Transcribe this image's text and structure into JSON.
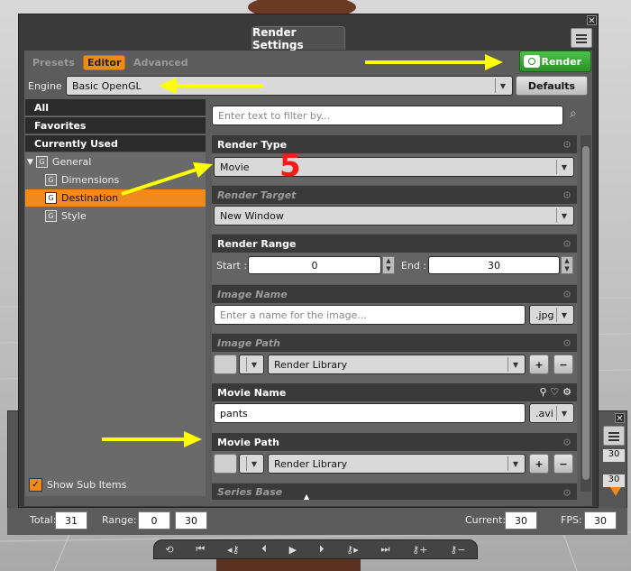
{
  "window": {
    "title": "Render Settings",
    "close_glyph": "✕"
  },
  "tabs": [
    {
      "label": "Presets"
    },
    {
      "label": "Editor",
      "active": true
    },
    {
      "label": "Advanced"
    }
  ],
  "render_button": {
    "label": "Render",
    "color": "#3fae3b"
  },
  "engine": {
    "label": "Engine :",
    "value": "Basic OpenGL",
    "defaults_label": "Defaults"
  },
  "filter": {
    "placeholder": "Enter text to filter by..."
  },
  "sidebar": {
    "items": [
      {
        "label": "All"
      },
      {
        "label": "Favorites"
      },
      {
        "label": "Currently Used"
      }
    ],
    "tree": [
      {
        "label": "General",
        "expanded": true
      },
      {
        "label": "Dimensions"
      },
      {
        "label": "Destination",
        "selected": true
      },
      {
        "label": "Style"
      }
    ],
    "show_sub_items": {
      "label": "Show Sub Items",
      "checked": true
    }
  },
  "sections": {
    "render_type": {
      "title": "Render Type",
      "value": "Movie"
    },
    "render_target": {
      "title": "Render Target",
      "value": "New Window"
    },
    "render_range": {
      "title": "Render Range",
      "start_label": "Start :",
      "start": "0",
      "end_label": "End :",
      "end": "30"
    },
    "image_name": {
      "title": "Image Name",
      "placeholder": "Enter a name for the image...",
      "ext": ".jpg"
    },
    "image_path": {
      "title": "Image Path",
      "value": "Render Library"
    },
    "movie_name": {
      "title": "Movie Name",
      "value": "pants",
      "ext": ".avi"
    },
    "movie_path": {
      "title": "Movie Path",
      "value": "Render Library"
    },
    "series_base": {
      "title": "Series Base"
    }
  },
  "annotation": {
    "number": "5",
    "color": "#ff1a1a",
    "arrow_color": "#ffff00"
  },
  "timeline": {
    "total_label": "Total:",
    "total": "31",
    "range_label": "Range:",
    "range_start": "0",
    "range_end": "30",
    "current_label": "Current:",
    "current": "30",
    "fps_label": "FPS:",
    "fps": "30",
    "side_values": [
      "30",
      "30"
    ]
  },
  "plus_label": "+",
  "minus_label": "−"
}
